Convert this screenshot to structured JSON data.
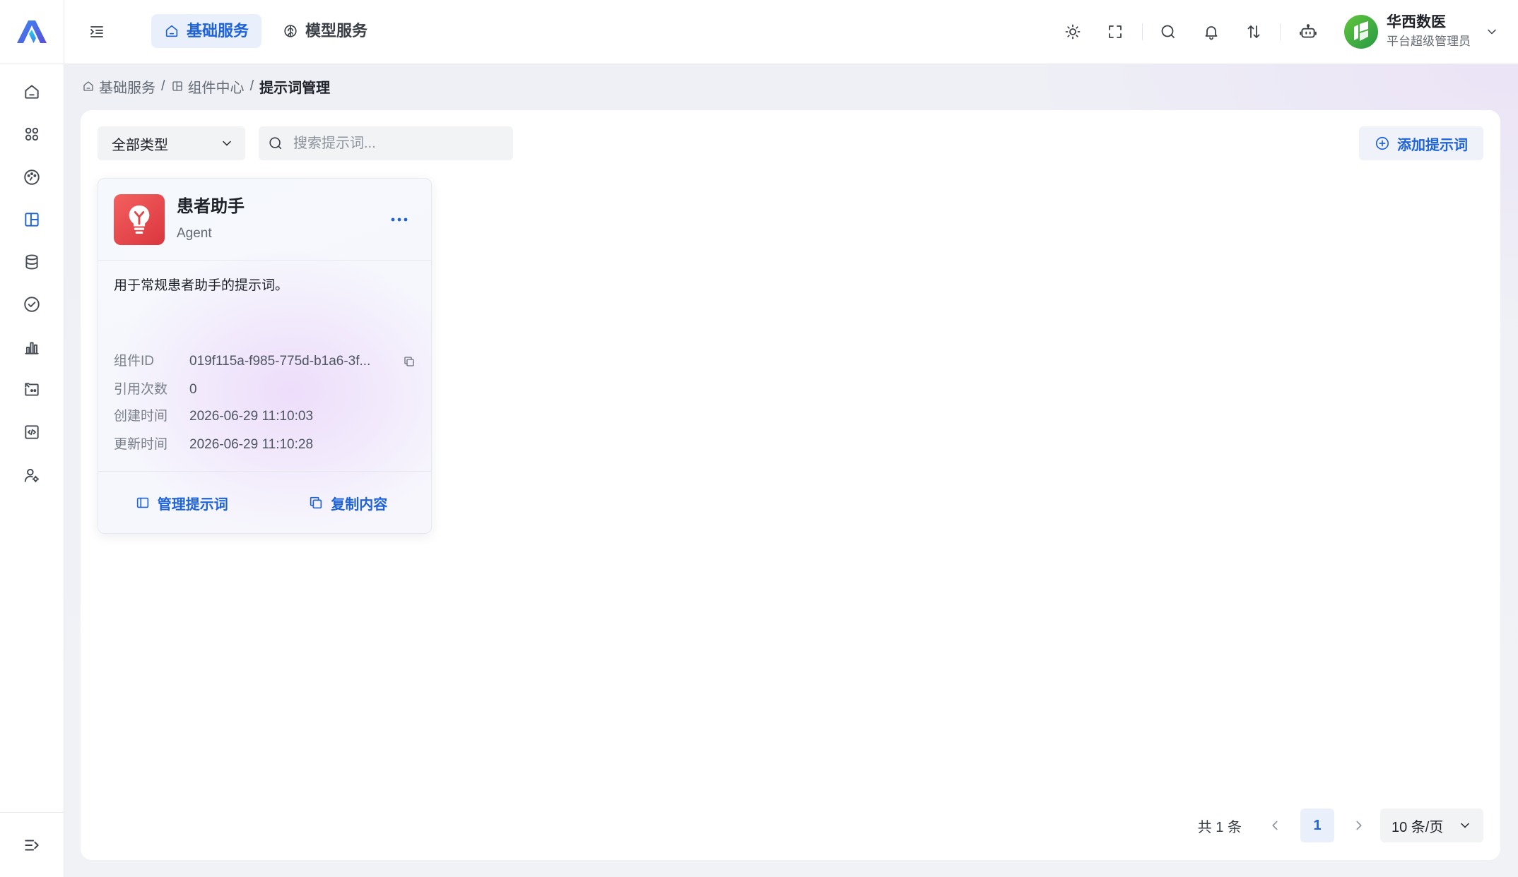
{
  "theme": {
    "primary": "#1f63d9",
    "active_bg": "#e9f0fc",
    "text": "#1f2329",
    "muted": "#646a73"
  },
  "app": {
    "logo_icon": "app-logo-icon"
  },
  "header": {
    "menu_toggle_icon": "indent-icon",
    "tabs": [
      {
        "label": "基础服务",
        "icon": "home-icon",
        "active": true
      },
      {
        "label": "模型服务",
        "icon": "brain-icon",
        "active": false
      }
    ],
    "action_icons": [
      "sun-icon",
      "fullscreen-icon",
      "search-icon",
      "bell-icon",
      "sort-icon",
      "robot-icon"
    ],
    "user": {
      "name": "华西数医",
      "role": "平台超级管理员",
      "avatar_icon": "avatar-logo-icon",
      "menu_icon": "chevron-down-icon"
    }
  },
  "sidebar": {
    "items": [
      {
        "icon": "home-icon",
        "active": false
      },
      {
        "icon": "apps-icon",
        "active": false
      },
      {
        "icon": "dashboard-icon",
        "active": false
      },
      {
        "icon": "layout-icon",
        "active": true
      },
      {
        "icon": "database-icon",
        "active": false
      },
      {
        "icon": "check-circle-icon",
        "active": false
      },
      {
        "icon": "bar-chart-icon",
        "active": false
      },
      {
        "icon": "plugin-icon",
        "active": false
      },
      {
        "icon": "code-icon",
        "active": false
      },
      {
        "icon": "user-settings-icon",
        "active": false
      }
    ],
    "collapse_icon": "expand-icon"
  },
  "breadcrumb": {
    "separator": "/",
    "items": [
      {
        "label": "基础服务",
        "icon": "home-icon"
      },
      {
        "label": "组件中心",
        "icon": "layout-icon"
      },
      {
        "label": "提示词管理"
      }
    ]
  },
  "toolbar": {
    "type_filter": "全部类型",
    "search_placeholder": "搜索提示词...",
    "add_label": "添加提示词",
    "add_icon": "plus-circle-icon"
  },
  "cards": [
    {
      "title": "患者助手",
      "type": "Agent",
      "icon": "lightbulb-icon",
      "description": "用于常规患者助手的提示词。",
      "fields": [
        {
          "label": "组件ID",
          "value": "019f115a-f985-775d-b1a6-3f...",
          "copy_icon": "copy-icon"
        },
        {
          "label": "引用次数",
          "value": "0"
        },
        {
          "label": "创建时间",
          "value": "2026-06-29 11:10:03"
        },
        {
          "label": "更新时间",
          "value": "2026-06-29 11:10:28"
        }
      ],
      "actions": [
        {
          "label": "管理提示词",
          "icon": "panel-icon"
        },
        {
          "label": "复制内容",
          "icon": "copy-icon"
        }
      ]
    }
  ],
  "pagination": {
    "total": "共 1 条",
    "current_page": "1",
    "page_size": "10 条/页"
  }
}
